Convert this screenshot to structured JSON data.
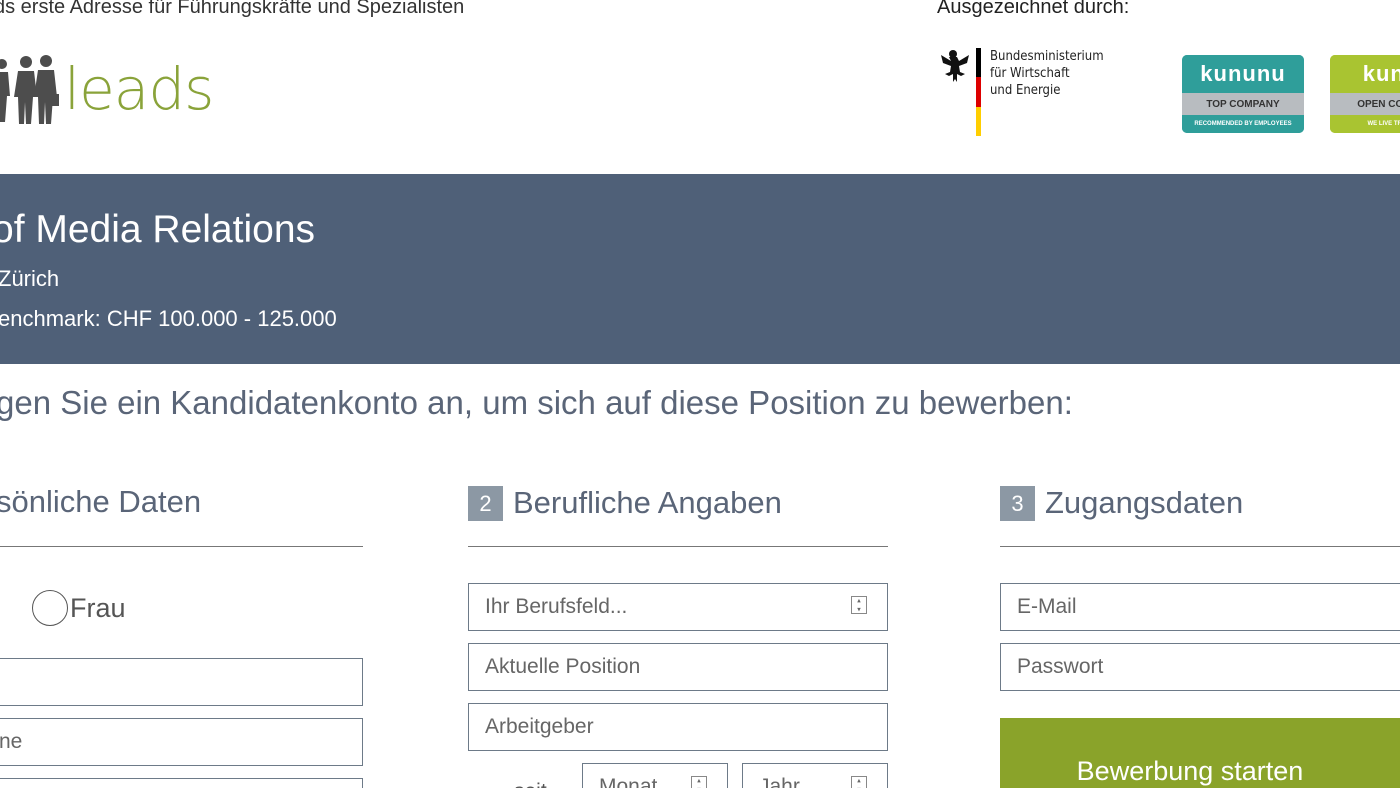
{
  "header": {
    "tagline": "ds erste Adresse für Führungskräfte und Spezialisten",
    "logo_text": "leads",
    "award_label": "Ausgezeichnet durch:",
    "bmwi": {
      "line1": "Bundesministerium",
      "line2": "für Wirtschaft",
      "line3": "und Energie"
    },
    "badges": [
      {
        "brand": "kununu",
        "title": "TOP COMPANY",
        "footer": "RECOMMENDED BY EMPLOYEES",
        "color": "#2f9e9a"
      },
      {
        "brand": "kunu",
        "title": "OPEN COMPA",
        "footer": "WE LIVE TRANS",
        "color": "#a9c431"
      }
    ]
  },
  "job": {
    "title": "of Media Relations",
    "location": "Zürich",
    "salary": "enchmark: CHF 100.000 - 125.000"
  },
  "intro": "gen Sie ein Kandidatenkonto an, um sich auf diese Position zu bewerben:",
  "sections": {
    "personal": {
      "heading": "sönliche Daten",
      "radio_label": "Frau",
      "field2_placeholder": "ne"
    },
    "professional": {
      "number": "2",
      "heading": "Berufliche Angaben",
      "field_berufsfeld": "Ihr Berufsfeld...",
      "field_position": "Aktuelle Position",
      "field_arbeitgeber": "Arbeitgeber",
      "since_label": "seit",
      "month_placeholder": "Monat",
      "year_placeholder": "Jahr"
    },
    "access": {
      "number": "3",
      "heading": "Zugangsdaten",
      "email_placeholder": "E-Mail",
      "password_placeholder": "Passwort",
      "submit_label": "Bewerbung starten"
    }
  },
  "colors": {
    "hero_bg": "#4f6078",
    "brand_green": "#8aa32a",
    "section_number_bg": "#8c98a4"
  },
  "icons": {
    "select": "select-arrows-icon",
    "eagle": "federal-eagle-icon"
  }
}
